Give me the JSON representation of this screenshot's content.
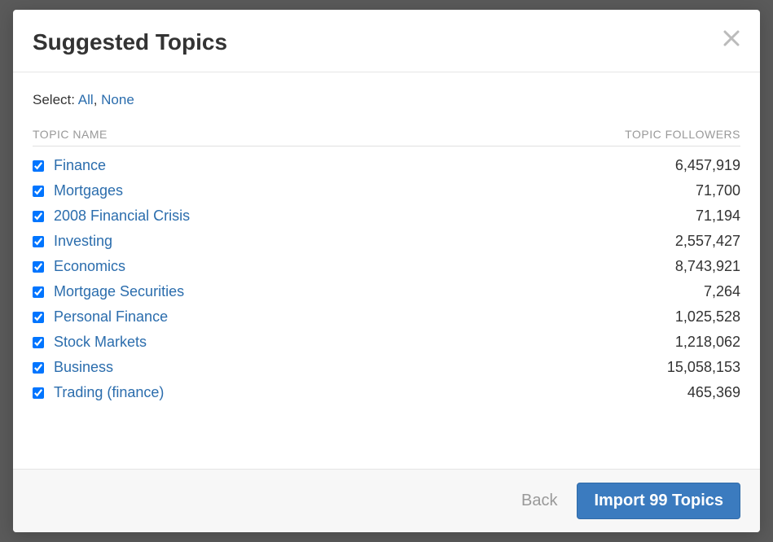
{
  "modal": {
    "title": "Suggested Topics",
    "select_label": "Select:",
    "select_all": "All",
    "select_none": "None",
    "col_name": "TOPIC NAME",
    "col_followers": "TOPIC FOLLOWERS",
    "back_label": "Back",
    "import_label": "Import 99 Topics"
  },
  "topics": [
    {
      "name": "Finance",
      "followers": "6,457,919",
      "checked": true
    },
    {
      "name": "Mortgages",
      "followers": "71,700",
      "checked": true
    },
    {
      "name": "2008 Financial Crisis",
      "followers": "71,194",
      "checked": true
    },
    {
      "name": "Investing",
      "followers": "2,557,427",
      "checked": true
    },
    {
      "name": "Economics",
      "followers": "8,743,921",
      "checked": true
    },
    {
      "name": "Mortgage Securities",
      "followers": "7,264",
      "checked": true
    },
    {
      "name": "Personal Finance",
      "followers": "1,025,528",
      "checked": true
    },
    {
      "name": "Stock Markets",
      "followers": "1,218,062",
      "checked": true
    },
    {
      "name": "Business",
      "followers": "15,058,153",
      "checked": true
    },
    {
      "name": "Trading (finance)",
      "followers": "465,369",
      "checked": true
    }
  ]
}
